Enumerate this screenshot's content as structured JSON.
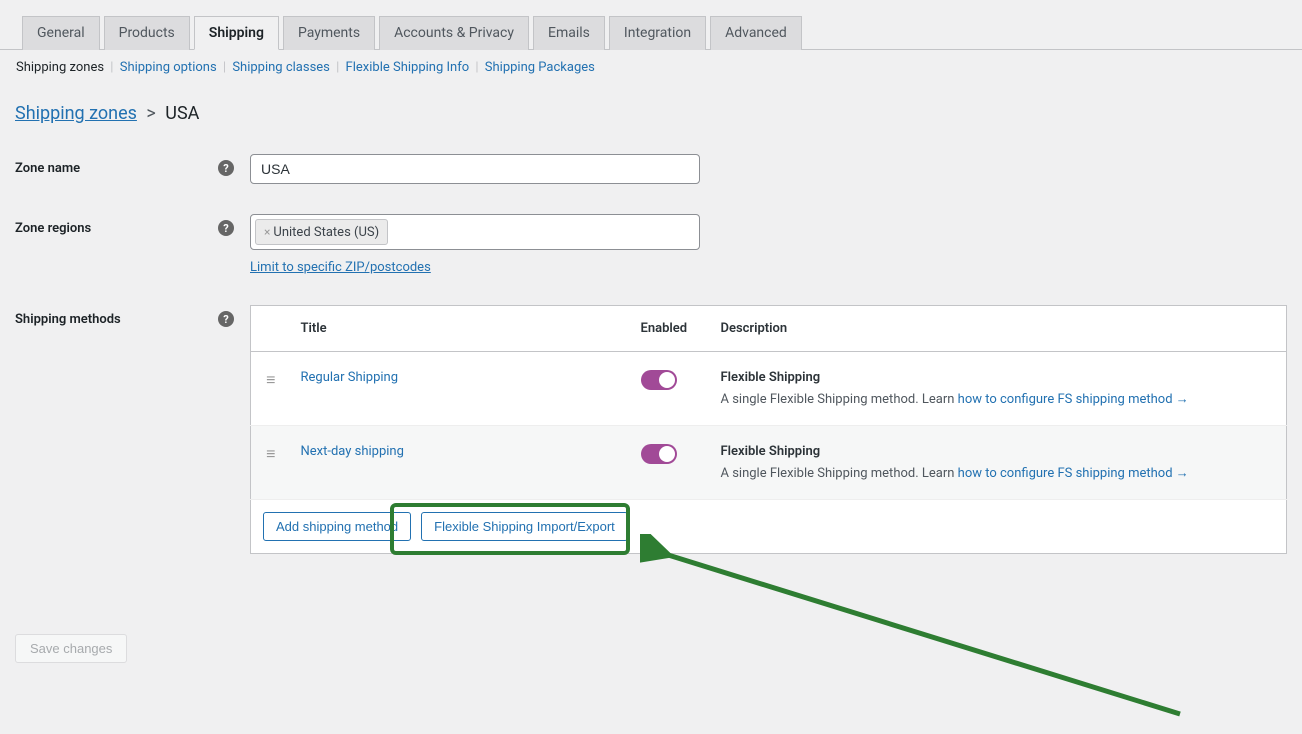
{
  "tabs": {
    "general": "General",
    "products": "Products",
    "shipping": "Shipping",
    "payments": "Payments",
    "accounts": "Accounts & Privacy",
    "emails": "Emails",
    "integration": "Integration",
    "advanced": "Advanced"
  },
  "subnav": {
    "zones": "Shipping zones",
    "options": "Shipping options",
    "classes": "Shipping classes",
    "flex_info": "Flexible Shipping Info",
    "packages": "Shipping Packages"
  },
  "breadcrumb": {
    "root": "Shipping zones",
    "current": "USA"
  },
  "form": {
    "zone_name_label": "Zone name",
    "zone_name_value": "USA",
    "zone_regions_label": "Zone regions",
    "region_tag": "United States (US)",
    "limit_link": "Limit to specific ZIP/postcodes",
    "methods_label": "Shipping methods"
  },
  "table": {
    "headers": {
      "title": "Title",
      "enabled": "Enabled",
      "description": "Description"
    },
    "rows": [
      {
        "title": "Regular Shipping",
        "desc_title": "Flexible Shipping",
        "desc_text": "A single Flexible Shipping method. Learn ",
        "desc_link": "how to configure FS shipping method →"
      },
      {
        "title": "Next-day shipping",
        "desc_title": "Flexible Shipping",
        "desc_text": "A single Flexible Shipping method. Learn ",
        "desc_link": "how to configure FS shipping method →"
      }
    ],
    "footer": {
      "add_method": "Add shipping method",
      "import_export": "Flexible Shipping Import/Export"
    }
  },
  "save_button": "Save changes"
}
